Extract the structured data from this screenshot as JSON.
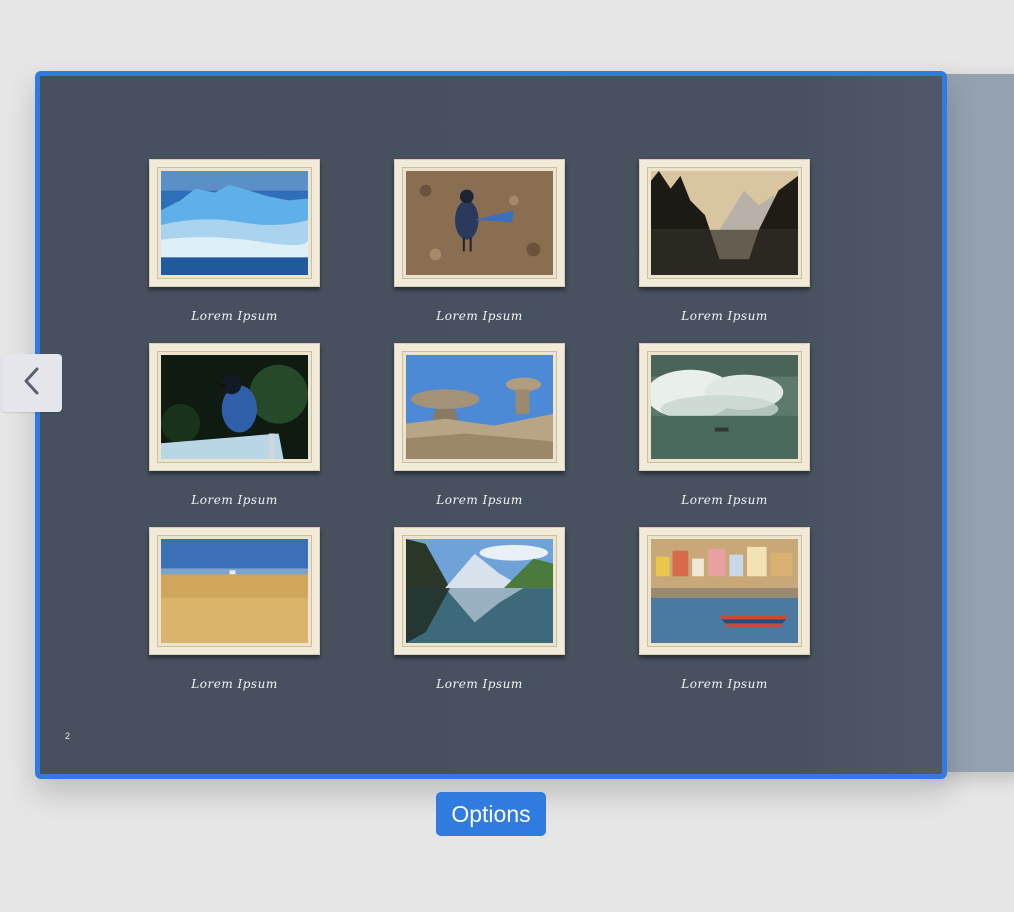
{
  "page": {
    "number": "2"
  },
  "gallery": {
    "items": [
      {
        "caption": "Lorem Ipsum",
        "subject": "icebergs"
      },
      {
        "caption": "Lorem Ipsum",
        "subject": "blue-jay-on-ground"
      },
      {
        "caption": "Lorem Ipsum",
        "subject": "mountain-lake-sunset"
      },
      {
        "caption": "Lorem Ipsum",
        "subject": "jay-on-car"
      },
      {
        "caption": "Lorem Ipsum",
        "subject": "rock-formations"
      },
      {
        "caption": "Lorem Ipsum",
        "subject": "waterfall-boat"
      },
      {
        "caption": "Lorem Ipsum",
        "subject": "wheat-field"
      },
      {
        "caption": "Lorem Ipsum",
        "subject": "mountain-lake"
      },
      {
        "caption": "Lorem Ipsum",
        "subject": "harbor-town"
      }
    ]
  },
  "navigation": {
    "prev_icon": "chevron-left-icon"
  },
  "toolbar": {
    "options_label": "Options"
  },
  "colors": {
    "accent": "#2f7be0",
    "page_background": "#46505f",
    "next_page": "#94a2b0",
    "frame": "#f1ead9"
  }
}
